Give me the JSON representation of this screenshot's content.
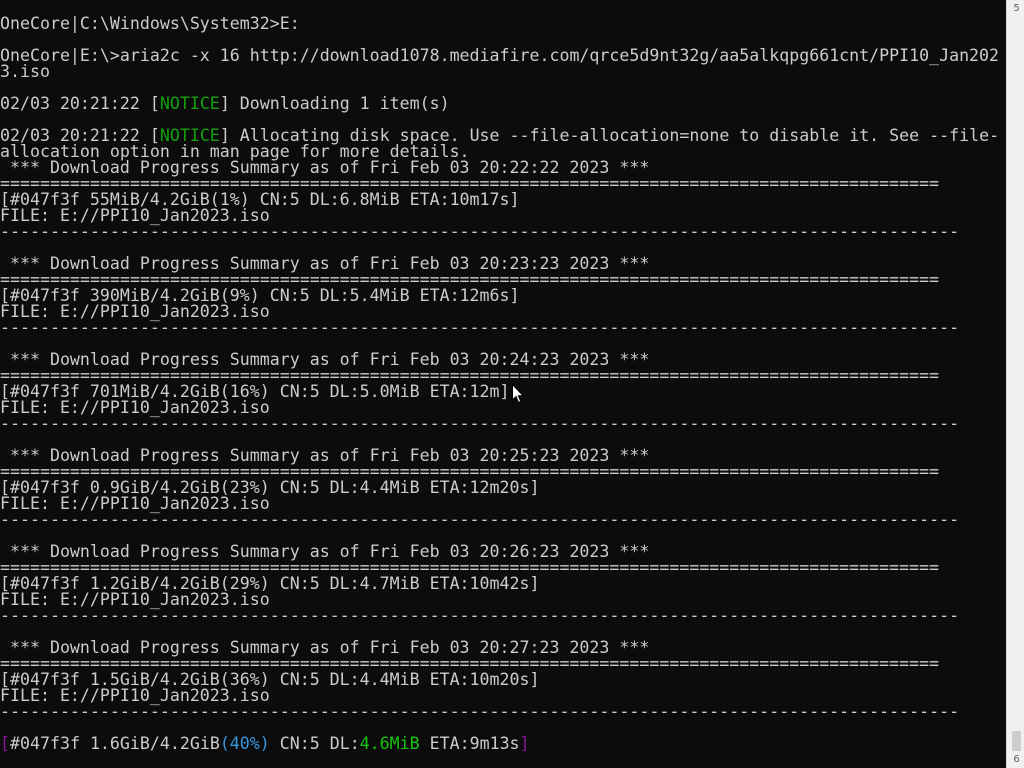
{
  "terminal": {
    "lines": [
      "OneCore|C:\\Windows\\System32>E:",
      "",
      "OneCore|E:\\>aria2c -x 16 http://download1078.mediafire.com/qrce5d9nt32g/aa5alkqpg661cnt/PPI10_Jan202",
      "3.iso",
      "",
      "02/03 20:21:22 [",
      "",
      "02/03 20:21:22 [",
      "allocation option in man page for more details.",
      " *** Download Progress Summary as of Fri Feb 03 20:22:22 2023 ***",
      "==============================================================================================",
      "[#047f3f 55MiB/4.2GiB(1%) CN:5 DL:6.8MiB ETA:10m17s]",
      "FILE: E://PPI10_Jan2023.iso",
      "------------------------------------------------------------------------------------------------",
      "",
      " *** Download Progress Summary as of Fri Feb 03 20:23:23 2023 ***",
      "==============================================================================================",
      "[#047f3f 390MiB/4.2GiB(9%) CN:5 DL:5.4MiB ETA:12m6s]",
      "FILE: E://PPI10_Jan2023.iso",
      "------------------------------------------------------------------------------------------------",
      "",
      " *** Download Progress Summary as of Fri Feb 03 20:24:23 2023 ***",
      "==============================================================================================",
      "[#047f3f 701MiB/4.2GiB(16%) CN:5 DL:5.0MiB ETA:12m]",
      "FILE: E://PPI10_Jan2023.iso",
      "------------------------------------------------------------------------------------------------",
      "",
      " *** Download Progress Summary as of Fri Feb 03 20:25:23 2023 ***",
      "==============================================================================================",
      "[#047f3f 0.9GiB/4.2GiB(23%) CN:5 DL:4.4MiB ETA:12m20s]",
      "FILE: E://PPI10_Jan2023.iso",
      "------------------------------------------------------------------------------------------------",
      "",
      " *** Download Progress Summary as of Fri Feb 03 20:26:23 2023 ***",
      "==============================================================================================",
      "[#047f3f 1.2GiB/4.2GiB(29%) CN:5 DL:4.7MiB ETA:10m42s]",
      "FILE: E://PPI10_Jan2023.iso",
      "------------------------------------------------------------------------------------------------",
      "",
      " *** Download Progress Summary as of Fri Feb 03 20:27:23 2023 ***",
      "==============================================================================================",
      "[#047f3f 1.5GiB/4.2GiB(36%) CN:5 DL:4.4MiB ETA:10m20s]",
      "FILE: E://PPI10_Jan2023.iso",
      "------------------------------------------------------------------------------------------------",
      "",
      ""
    ],
    "notice_line_1": {
      "prefix": "02/03 20:21:22 [",
      "tag": "NOTICE",
      "suffix": "] Downloading 1 item(s)"
    },
    "notice_line_2": {
      "prefix": "02/03 20:21:22 [",
      "tag": "NOTICE",
      "suffix": "] Allocating disk space. Use --file-allocation=none to disable it. See --file-"
    },
    "live_status": {
      "open": "[",
      "gid": "#047f3f",
      "progress": "1.6GiB/4.2GiB",
      "percent": "(40%)",
      "cn": " CN:5 DL:",
      "speed": "4.6MiB",
      "eta": " ETA:9m13s",
      "close": "]"
    }
  },
  "scrollbar": {
    "up_label": "5",
    "down_label": "6",
    "position_fraction": 1.0
  },
  "colors": {
    "background": "#0c0c0c",
    "foreground": "#cccccc",
    "notice": "#13a10e",
    "bracket_magenta": "#881798",
    "percent_cyan": "#3a96dd",
    "speed_green": "#16c60c"
  }
}
